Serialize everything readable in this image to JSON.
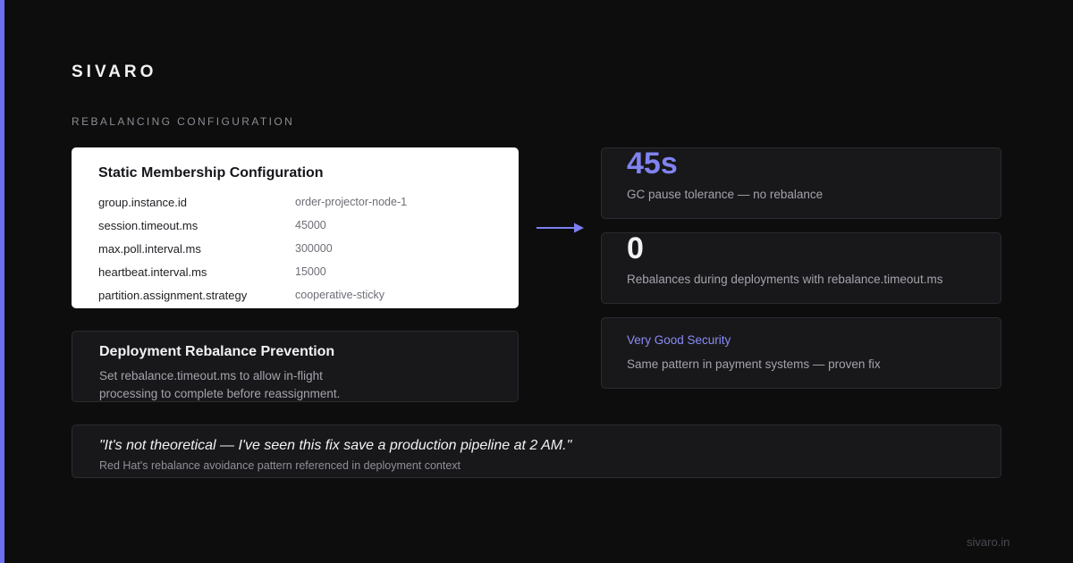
{
  "brand": "SIVARO",
  "section_label": "REBALANCING CONFIGURATION",
  "colors": {
    "accent": "#6b6ff0",
    "accent_text": "#8083f0",
    "background": "#0d0d0d",
    "card_bg": "#18181b"
  },
  "config": {
    "title": "Static Membership Configuration",
    "rows": [
      {
        "key": "group.instance.id",
        "value": "order-projector-node-1"
      },
      {
        "key": "session.timeout.ms",
        "value": "45000"
      },
      {
        "key": "max.poll.interval.ms",
        "value": "300000"
      },
      {
        "key": "heartbeat.interval.ms",
        "value": "15000"
      },
      {
        "key": "partition.assignment.strategy",
        "value": "cooperative-sticky"
      }
    ]
  },
  "prevention": {
    "title": "Deployment Rebalance Prevention",
    "body": "Set rebalance.timeout.ms to allow in-flight processing to complete before reassignment."
  },
  "stats": [
    {
      "value": "45s",
      "description": "GC pause tolerance — no rebalance"
    },
    {
      "value": "0",
      "description": "Rebalances during deployments with rebalance.timeout.ms"
    },
    {
      "title": "Very Good Security",
      "description": "Same pattern in payment systems — proven fix"
    }
  ],
  "quote": {
    "text": "\"It's not theoretical — I've seen this fix save a production pipeline at 2 AM.\"",
    "source": "Red Hat's rebalance avoidance pattern referenced in deployment context"
  },
  "footer_url": "sivaro.in",
  "icons": {
    "arrow": "arrow-right-icon"
  }
}
